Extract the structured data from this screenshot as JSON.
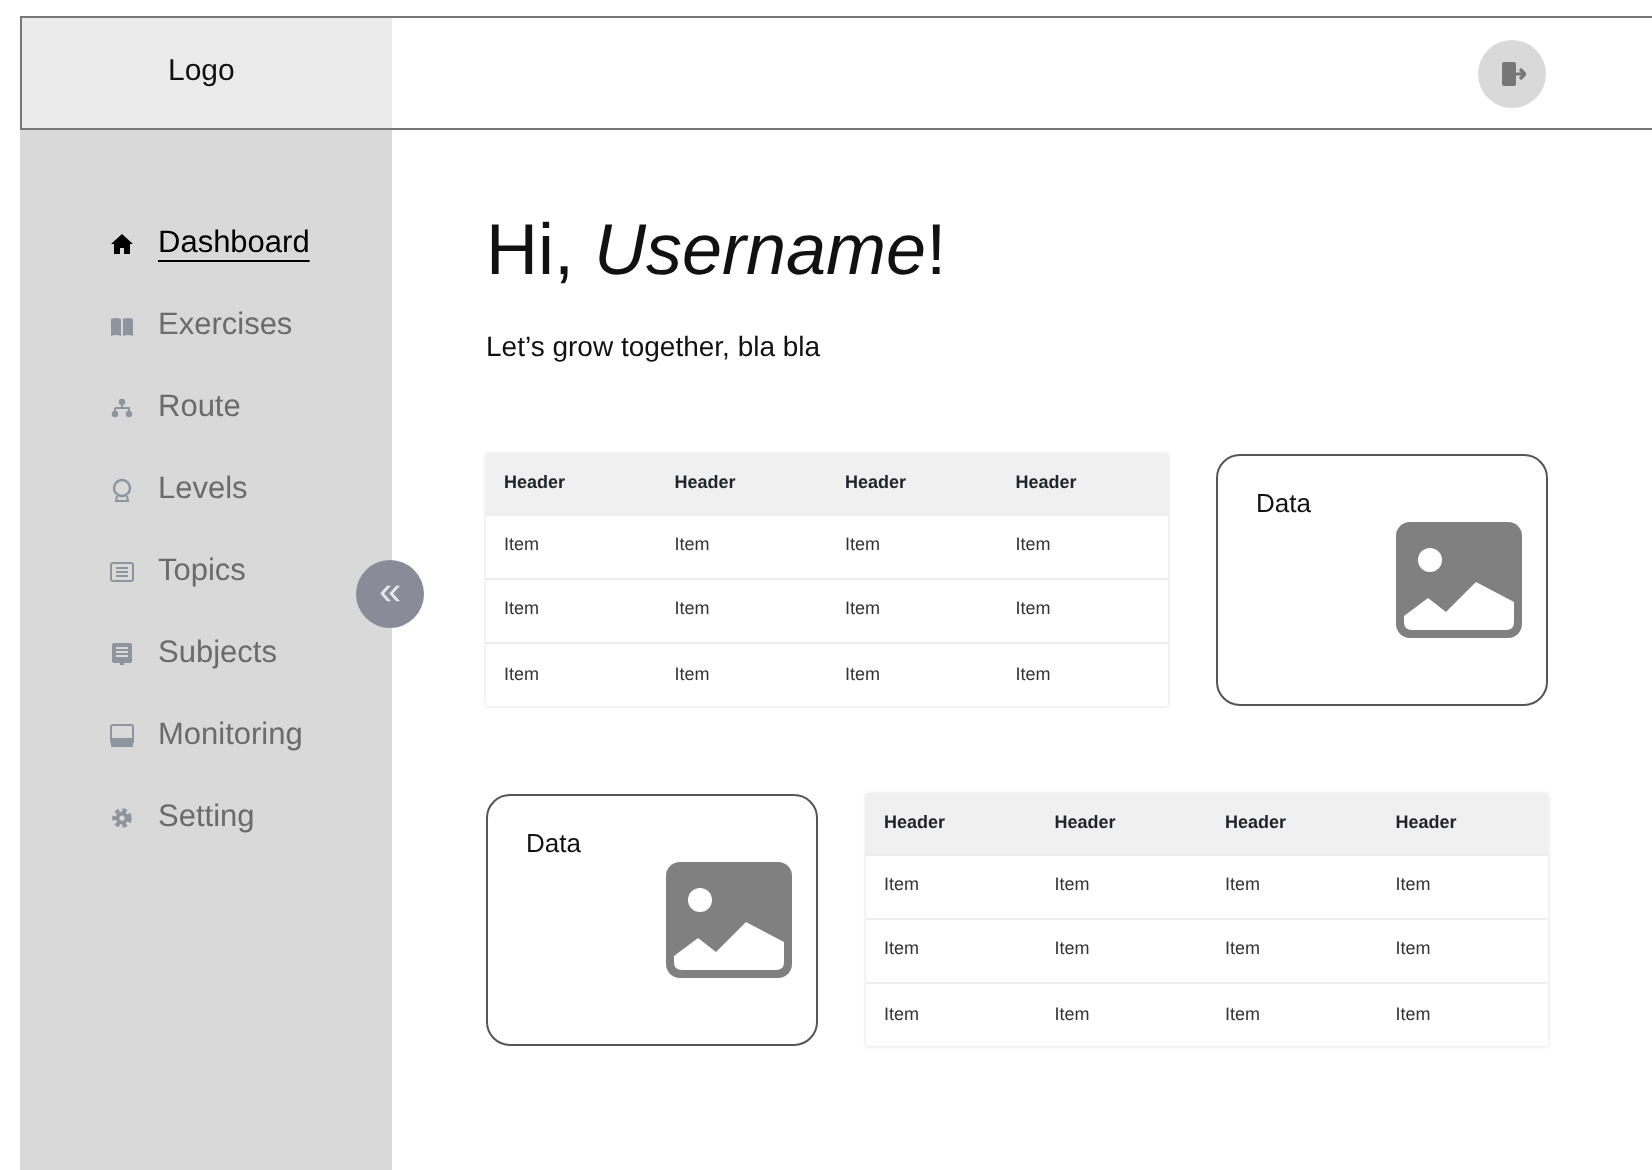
{
  "header": {
    "logo": "Logo"
  },
  "sidebar": {
    "items": [
      {
        "label": "Dashboard",
        "selected": true
      },
      {
        "label": "Exercises",
        "selected": false
      },
      {
        "label": "Route",
        "selected": false
      },
      {
        "label": "Levels",
        "selected": false
      },
      {
        "label": "Topics",
        "selected": false
      },
      {
        "label": "Subjects",
        "selected": false
      },
      {
        "label": "Monitoring",
        "selected": false
      },
      {
        "label": "Setting",
        "selected": false
      }
    ],
    "collapse_button": "«"
  },
  "greeting": "Hi, *Username*!",
  "subtitle": "Let’s grow together, bla bla",
  "rows": [
    {
      "panels": [
        {
          "kind": "table",
          "columns": [
            "Header",
            "Header",
            "Header",
            "Header"
          ],
          "rows": [
            [
              "Item",
              "Item",
              "Item",
              "Item"
            ],
            [
              "Item",
              "Item",
              "Item",
              "Item"
            ],
            [
              "Item",
              "Item",
              "Item",
              "Item"
            ]
          ]
        },
        {
          "kind": "card",
          "label": "Data"
        }
      ]
    },
    {
      "panels": [
        {
          "kind": "card",
          "label": "Data"
        },
        {
          "kind": "table",
          "columns": [
            "Header",
            "Header",
            "Header",
            "Header"
          ],
          "rows": [
            [
              "Item",
              "Item",
              "Item",
              "Item"
            ],
            [
              "Item",
              "Item",
              "Item",
              "Item"
            ],
            [
              "Item",
              "Item",
              "Item",
              "Item"
            ]
          ]
        }
      ]
    }
  ]
}
